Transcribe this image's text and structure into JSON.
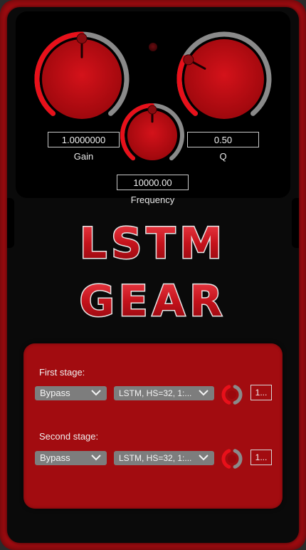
{
  "knobs": {
    "gain": {
      "label": "Gain",
      "value": "1.0000000",
      "level": 0.5
    },
    "q": {
      "label": "Q",
      "value": "0.50",
      "level": 0.28
    },
    "frequency": {
      "label": "Frequency",
      "value": "10000.00",
      "level": 0.5
    }
  },
  "logo": {
    "line1": "LSTM",
    "line2": "GEAR"
  },
  "stages": [
    {
      "label": "First stage:",
      "mode": "Bypass",
      "model": "LSTM, HS=32, 1:...",
      "button": "1..."
    },
    {
      "label": "Second stage:",
      "mode": "Bypass",
      "model": "LSTM, HS=32, 1:...",
      "button": "1..."
    }
  ],
  "colors": {
    "pedal_red": "#b00d12",
    "panel_red": "#a20c10",
    "knob_red": "#cc0a10",
    "accent_red": "#e8101a",
    "track_gray": "#8a8a8a",
    "combo_gray": "#7d7d7d"
  }
}
